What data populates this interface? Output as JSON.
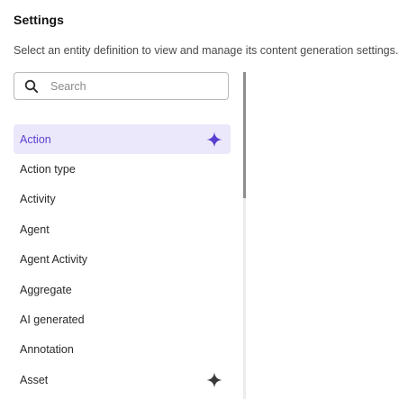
{
  "header": {
    "title": "Settings",
    "subtitle": "Select an entity definition to view and manage its content generation settings."
  },
  "search": {
    "placeholder": "Search",
    "value": "",
    "icon": "search-icon"
  },
  "entities": [
    {
      "label": "Action",
      "selected": true,
      "ai_icon": true
    },
    {
      "label": "Action type",
      "selected": false,
      "ai_icon": false
    },
    {
      "label": "Activity",
      "selected": false,
      "ai_icon": false
    },
    {
      "label": "Agent",
      "selected": false,
      "ai_icon": false
    },
    {
      "label": "Agent Activity",
      "selected": false,
      "ai_icon": false
    },
    {
      "label": "Aggregate",
      "selected": false,
      "ai_icon": false
    },
    {
      "label": "AI generated",
      "selected": false,
      "ai_icon": false
    },
    {
      "label": "Annotation",
      "selected": false,
      "ai_icon": false
    },
    {
      "label": "Asset",
      "selected": false,
      "ai_icon": true
    }
  ],
  "colors": {
    "selected_background": "#ece8fb",
    "selected_text": "#5b3fd0",
    "sparkle_selected": "#5b3fd0",
    "sparkle_default": "#3a3a3a"
  }
}
